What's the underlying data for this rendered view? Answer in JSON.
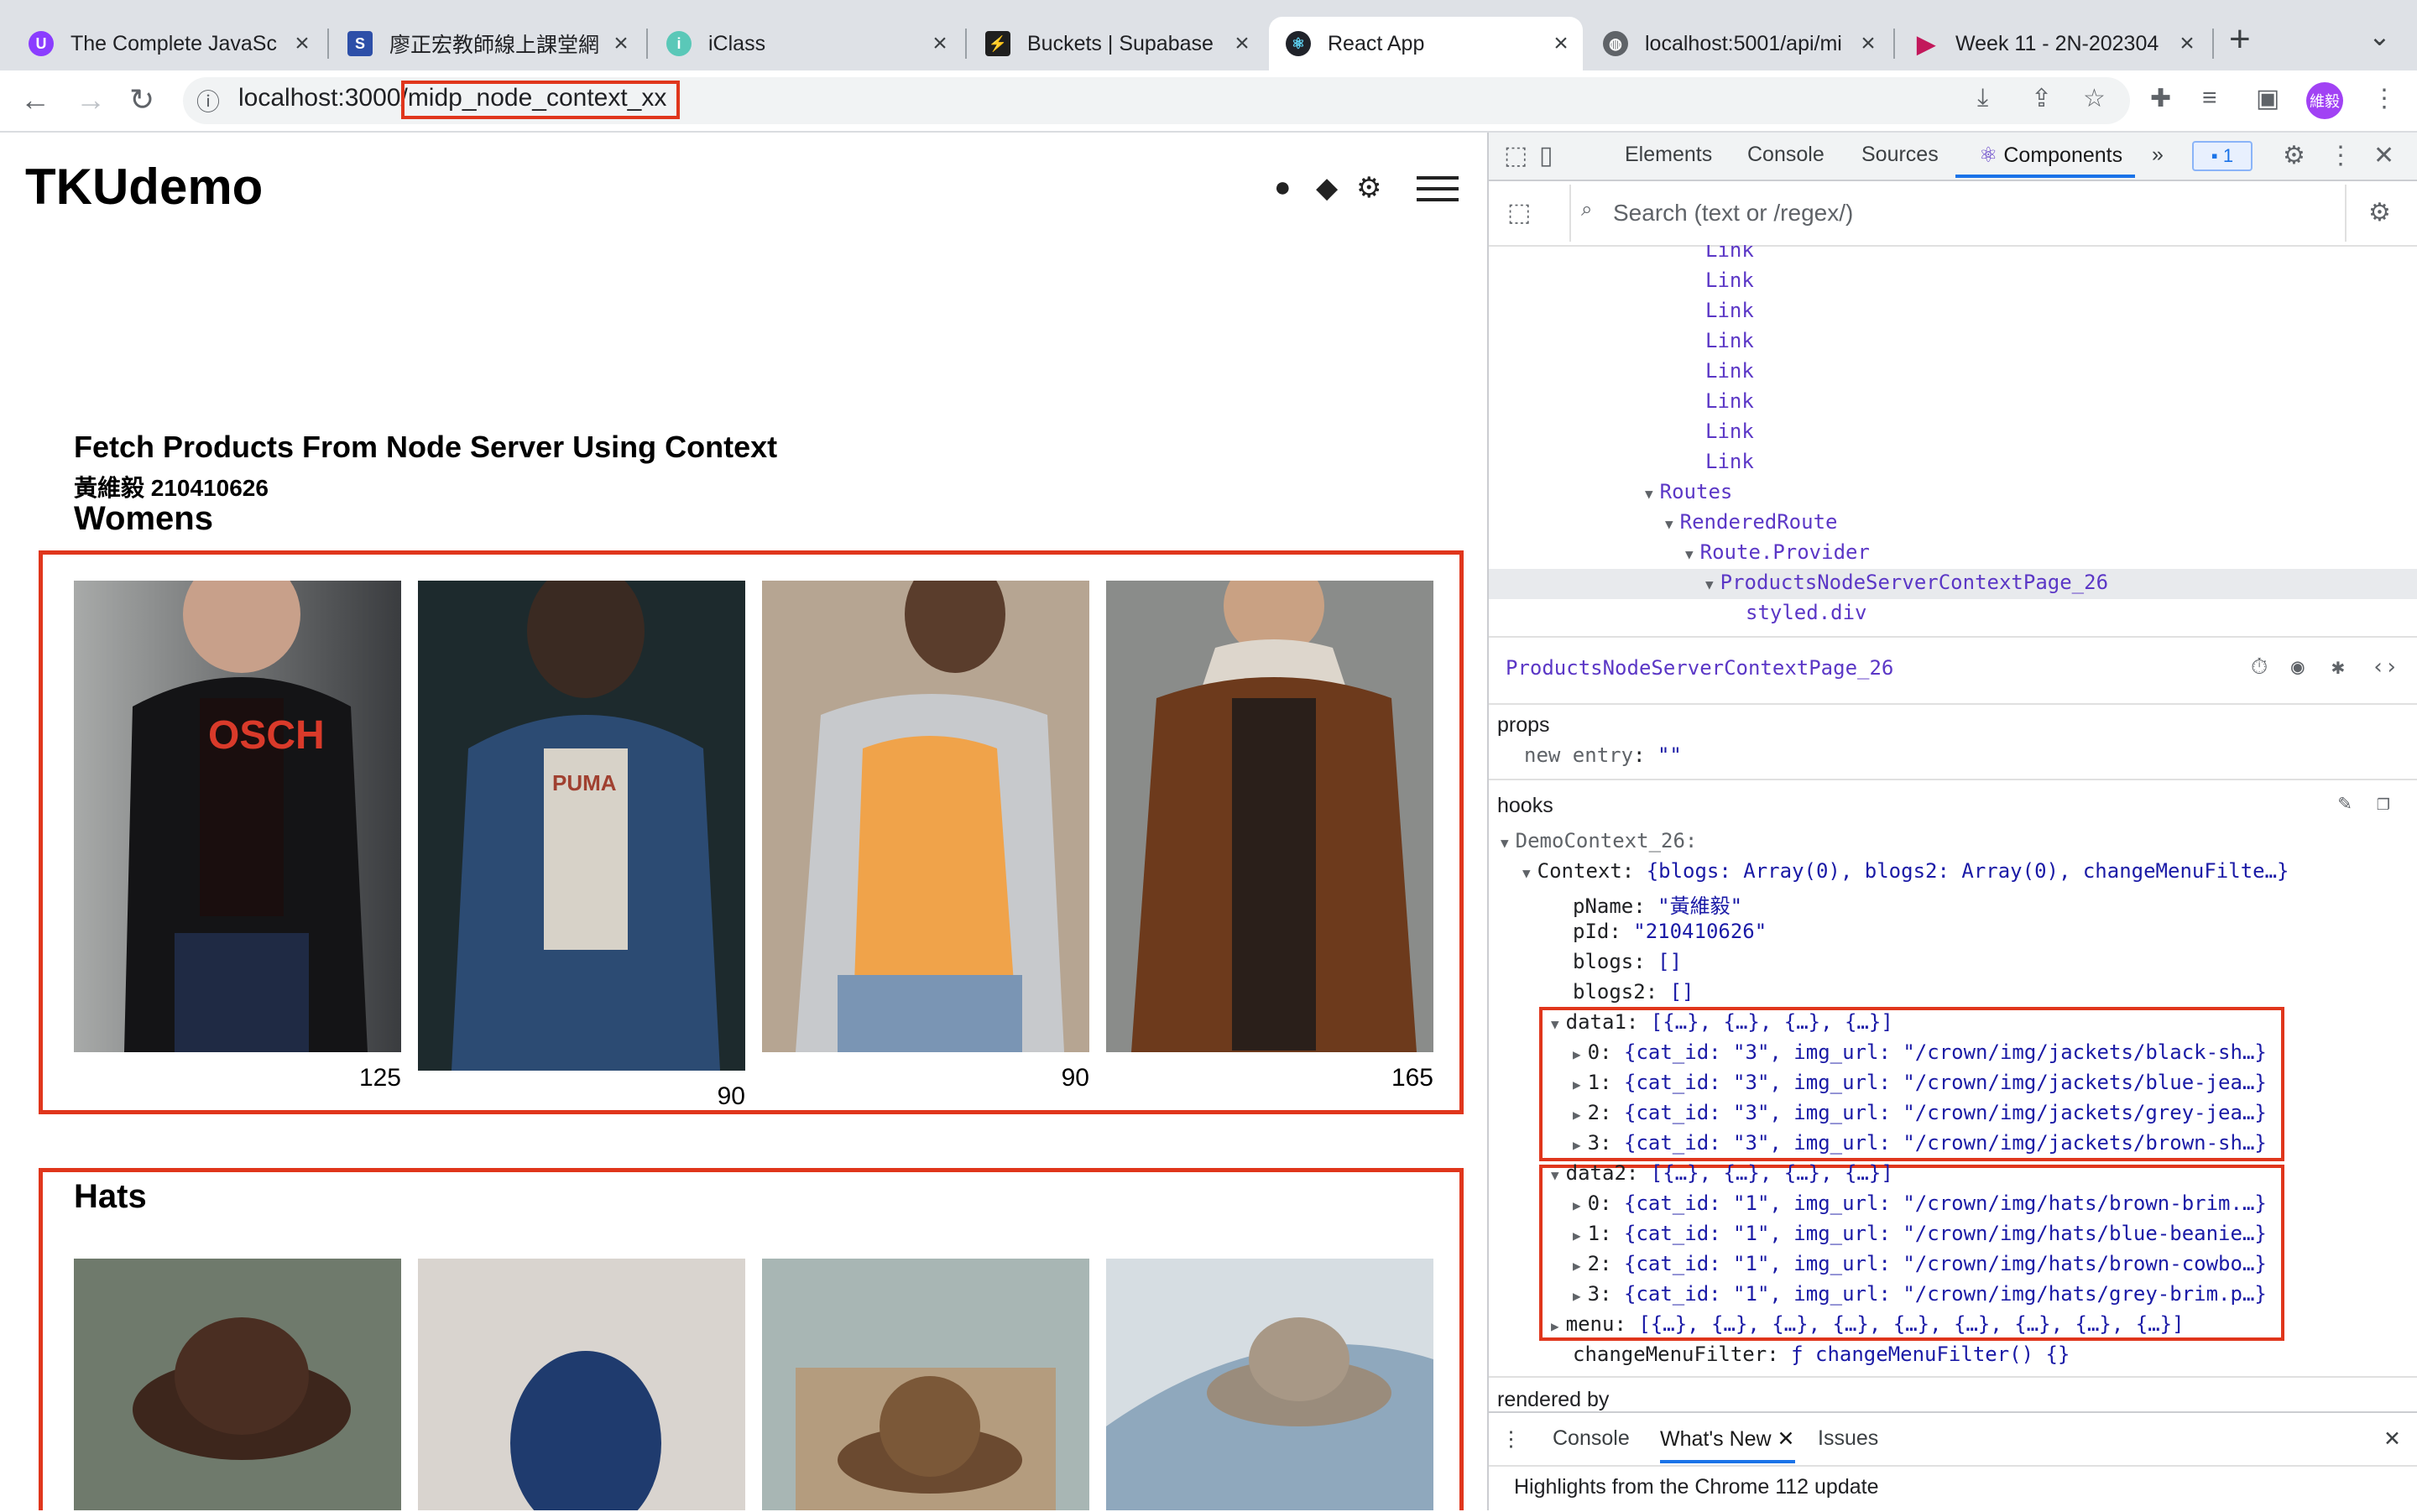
{
  "browser": {
    "tabs": [
      {
        "title": "The Complete JavaSc",
        "close": "×"
      },
      {
        "title": "廖正宏教師線上課堂網",
        "close": "×"
      },
      {
        "title": "iClass",
        "close": "×"
      },
      {
        "title": "Buckets | Supabase",
        "close": "×"
      },
      {
        "title": "React App",
        "close": "×"
      },
      {
        "title": "localhost:5001/api/mi",
        "close": "×"
      },
      {
        "title": "Week 11 - 2N-202304",
        "close": "×"
      }
    ],
    "new_tab": "+",
    "url_host": "localhost:3000",
    "url_path": "/midp_node_context_xx",
    "avatar": "維毅"
  },
  "page": {
    "brand": "TKUdemo",
    "title": "Fetch Products From Node Server Using Context",
    "student": "黃維毅 210410626",
    "categories": [
      {
        "name": "Womens",
        "prices": [
          "125",
          "90",
          "90",
          "165"
        ]
      },
      {
        "name": "Hats"
      }
    ]
  },
  "devtools": {
    "tabs": [
      "Elements",
      "Console",
      "Sources",
      "Components"
    ],
    "more": "»",
    "issues_badge": "1",
    "search_placeholder": "Search (text or /regex/)",
    "tree": [
      "Link",
      "Link",
      "Link",
      "Link",
      "Link",
      "Link",
      "Link",
      "Link",
      "Routes",
      "RenderedRoute",
      "Route.Provider",
      "ProductsNodeServerContextPage_26",
      "styled.div"
    ],
    "selected": "ProductsNodeServerContextPage_26",
    "props_label": "props",
    "props_key": "new entry",
    "props_val": "\"\"",
    "hooks_label": "hooks",
    "hook_name": "DemoContext_26:",
    "context_key": "Context:",
    "context_val": "{blogs: Array(0), blogs2: Array(0), changeMenuFilte…}",
    "pname_key": "pName:",
    "pname_val": "\"黃維毅\"",
    "pid_key": "pId:",
    "pid_val": "\"210410626\"",
    "blogs_key": "blogs:",
    "blogs_val": "[]",
    "blogs2_key": "blogs2:",
    "blogs2_val": "[]",
    "data1_key": "data1:",
    "data1_val": "[{…}, {…}, {…}, {…}]",
    "data1_items": [
      {
        "i": "0:",
        "cat": "\"3\"",
        "img": "\"/crown/img/jackets/black-sh…}"
      },
      {
        "i": "1:",
        "cat": "\"3\"",
        "img": "\"/crown/img/jackets/blue-jea…}"
      },
      {
        "i": "2:",
        "cat": "\"3\"",
        "img": "\"/crown/img/jackets/grey-jea…}"
      },
      {
        "i": "3:",
        "cat": "\"3\"",
        "img": "\"/crown/img/jackets/brown-sh…}"
      }
    ],
    "data2_key": "data2:",
    "data2_val": "[{…}, {…}, {…}, {…}]",
    "data2_items": [
      {
        "i": "0:",
        "cat": "\"1\"",
        "img": "\"/crown/img/hats/brown-brim.…}"
      },
      {
        "i": "1:",
        "cat": "\"1\"",
        "img": "\"/crown/img/hats/blue-beanie…}"
      },
      {
        "i": "2:",
        "cat": "\"1\"",
        "img": "\"/crown/img/hats/brown-cowbo…}"
      },
      {
        "i": "3:",
        "cat": "\"1\"",
        "img": "\"/crown/img/hats/grey-brim.p…}"
      }
    ],
    "menu_key": "menu:",
    "menu_val": "[{…}, {…}, {…}, {…}, {…}, {…}, {…}, {…}, {…}]",
    "cmf_key": "changeMenuFilter:",
    "cmf_val": "ƒ changeMenuFilter() {}",
    "rendered_by": "rendered by",
    "drawer_tabs": [
      "Console",
      "What's New",
      "Issues"
    ],
    "drawer_message": "Highlights from the Chrome 112 update"
  },
  "colors": {
    "highlight_box": "#e0361c",
    "link_purple": "#5b37c6",
    "accent_blue": "#1a73e8"
  }
}
